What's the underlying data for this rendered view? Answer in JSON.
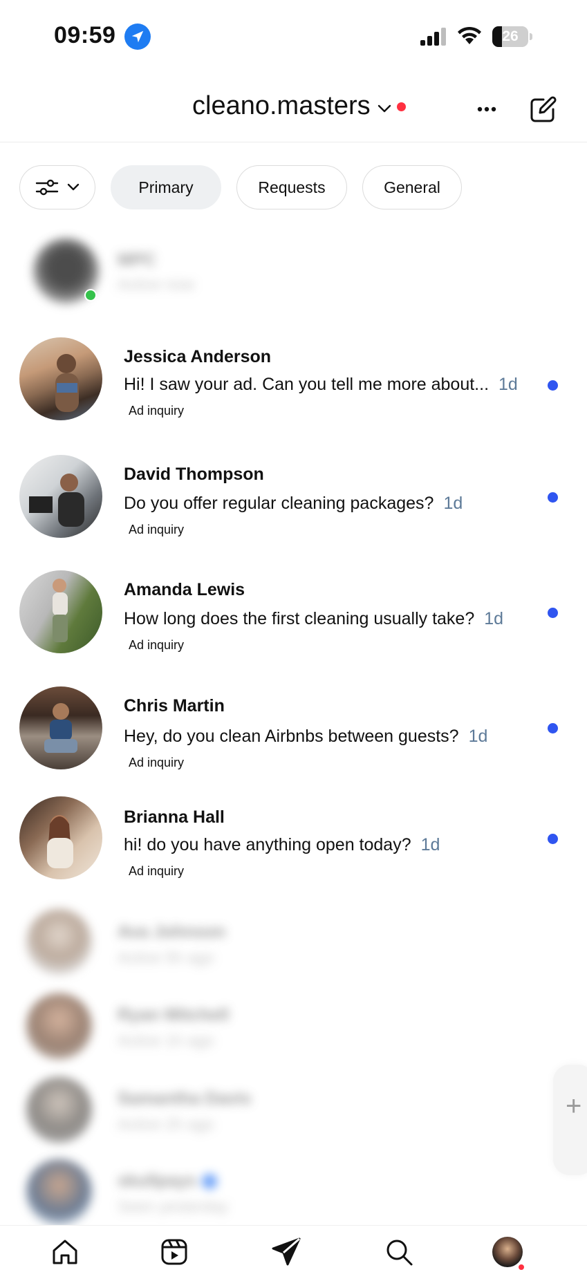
{
  "status_bar": {
    "time": "09:59",
    "battery_level": "26",
    "icons": [
      "location-arrow-icon",
      "signal-icon",
      "wifi-icon",
      "battery-icon"
    ]
  },
  "header": {
    "account_name": "cleano.masters",
    "icons": [
      "chevron-down-icon",
      "more-icon",
      "compose-icon"
    ],
    "accent_color": "#ff3040"
  },
  "filters": {
    "chips": [
      {
        "label": "Primary",
        "active": true
      },
      {
        "label": "Requests",
        "active": false
      },
      {
        "label": "General",
        "active": false
      }
    ]
  },
  "conversations": [
    {
      "name": "MPC",
      "subtitle": "Active now",
      "blurred": true,
      "online": true
    },
    {
      "name": "Jessica Anderson",
      "preview": "Hi! I saw your ad. Can you tell me more about...",
      "time": "1d",
      "tag": "Ad inquiry",
      "unread": true
    },
    {
      "name": "David Thompson",
      "preview": "Do you offer regular cleaning packages?",
      "time": "1d",
      "tag": "Ad inquiry",
      "unread": true
    },
    {
      "name": "Amanda Lewis",
      "preview": "How long does the first cleaning usually take?",
      "time": "1d",
      "tag": "Ad inquiry",
      "unread": true
    },
    {
      "name": "Chris Martin",
      "preview": "Hey, do you clean Airbnbs between guests?",
      "time": "1d",
      "tag": "Ad inquiry",
      "unread": true
    },
    {
      "name": "Brianna Hall",
      "preview": "hi! do you have anything open today?",
      "time": "1d",
      "tag": "Ad inquiry",
      "unread": true
    },
    {
      "name": "Ava Johnson",
      "subtitle": "Active 5h ago",
      "blurred": true
    },
    {
      "name": "Ryan Mitchell",
      "subtitle": "Active 1h ago",
      "blurred": true
    },
    {
      "name": "Samantha Davis",
      "subtitle": "Active 2h ago",
      "blurred": true
    },
    {
      "name": "skullpays",
      "subtitle": "Seen yesterday",
      "blurred": true,
      "verified": true
    }
  ],
  "unread_color": "#2f55f0",
  "bottom_nav": {
    "items": [
      "home-icon",
      "reels-icon",
      "direct-icon",
      "search-icon",
      "profile-avatar"
    ]
  }
}
